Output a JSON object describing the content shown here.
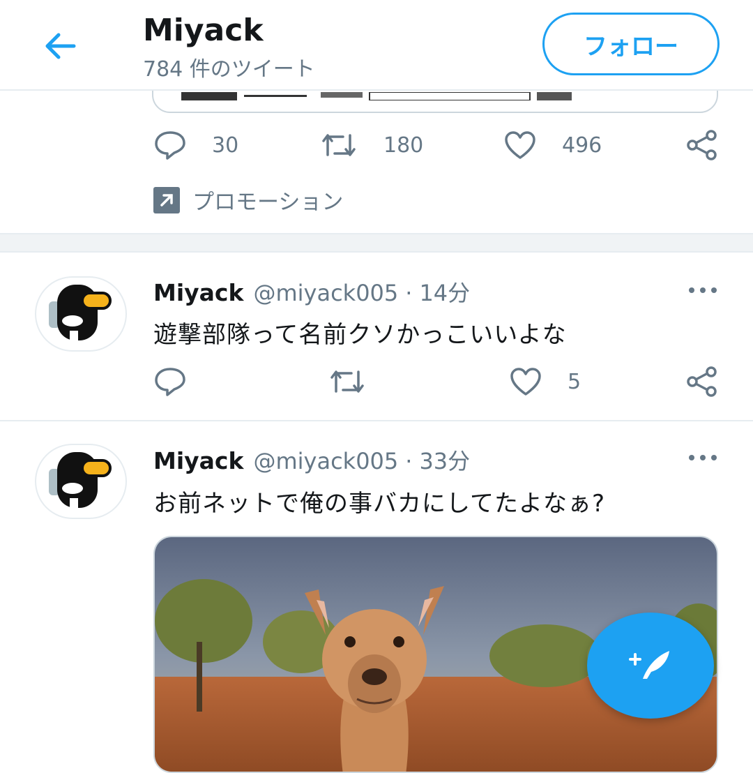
{
  "header": {
    "title": "Miyack",
    "tweet_count": "784 件のツイート",
    "follow_label": "フォロー"
  },
  "promoted_tweet": {
    "counts": {
      "reply": "30",
      "retweet": "180",
      "like": "496"
    },
    "promo_label": "プロモーション"
  },
  "tweets": [
    {
      "name": "Miyack",
      "handle": "@miyack005",
      "dot": "·",
      "time": "14分",
      "text": "遊撃部隊って名前クソかっこいいよな",
      "like_count": "5"
    },
    {
      "name": "Miyack",
      "handle": "@miyack005",
      "dot": "·",
      "time": "33分",
      "text": "お前ネットで俺の事バカにしてたよなぁ?",
      "media": "kangaroo-photo"
    }
  ],
  "icons": {
    "back": "back-arrow-icon",
    "reply": "reply-icon",
    "retweet": "retweet-icon",
    "like": "heart-icon",
    "share": "share-icon",
    "promo": "promoted-icon",
    "compose": "compose-tweet-icon"
  },
  "colors": {
    "accent": "#1da1f2",
    "text_primary": "#14171a",
    "text_secondary": "#657786",
    "border": "#e6ecf0"
  }
}
